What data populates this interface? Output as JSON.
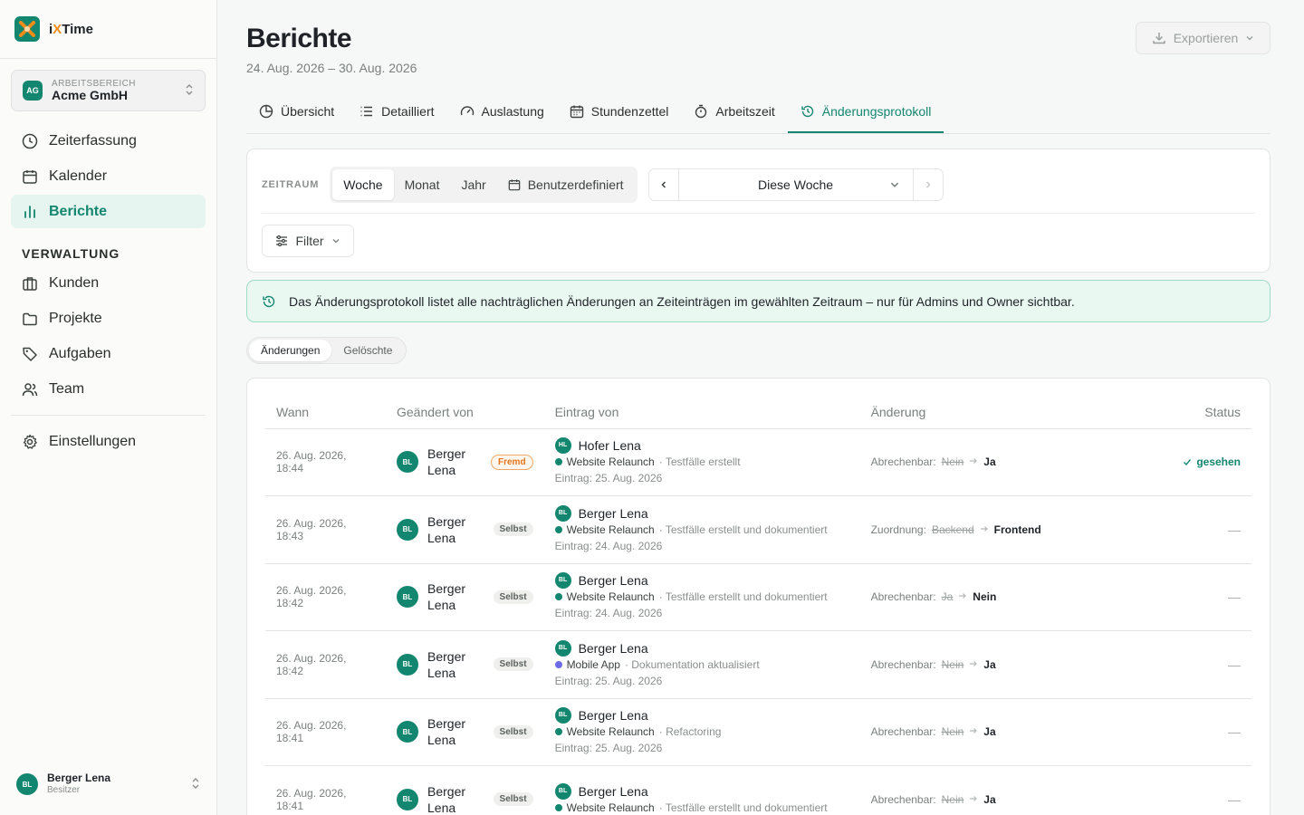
{
  "brand": {
    "name_prefix": "i",
    "name_x": "X",
    "name_suffix": "Time",
    "accent": "#13866f",
    "logo_accent": "#f08c1c"
  },
  "workspace": {
    "label": "ARBEITSBEREICH",
    "badge": "AG",
    "name": "Acme GmbH"
  },
  "nav": {
    "items": [
      {
        "label": "Zeiterfassung",
        "icon": "clock-icon"
      },
      {
        "label": "Kalender",
        "icon": "calendar-icon"
      },
      {
        "label": "Berichte",
        "icon": "bar-chart-icon",
        "active": true
      }
    ],
    "section": "VERWALTUNG",
    "admin_items": [
      {
        "label": "Kunden",
        "icon": "briefcase-icon"
      },
      {
        "label": "Projekte",
        "icon": "folder-icon"
      },
      {
        "label": "Aufgaben",
        "icon": "tag-icon"
      },
      {
        "label": "Team",
        "icon": "users-icon"
      }
    ],
    "settings": {
      "label": "Einstellungen",
      "icon": "gear-icon"
    }
  },
  "user": {
    "initials": "BL",
    "name": "Berger Lena",
    "role": "Besitzer"
  },
  "header": {
    "title": "Berichte",
    "subtitle": "24. Aug. 2026 – 30. Aug. 2026",
    "export_label": "Exportieren"
  },
  "tabs": [
    {
      "label": "Übersicht",
      "icon": "pie-icon"
    },
    {
      "label": "Detailliert",
      "icon": "list-icon"
    },
    {
      "label": "Auslastung",
      "icon": "gauge-icon"
    },
    {
      "label": "Stundenzettel",
      "icon": "calendar-icon"
    },
    {
      "label": "Arbeitszeit",
      "icon": "stopwatch-icon"
    },
    {
      "label": "Änderungsprotokoll",
      "icon": "history-icon",
      "active": true
    }
  ],
  "filters": {
    "zeitraum_label": "ZEITRAUM",
    "periods": [
      "Woche",
      "Monat",
      "Jahr"
    ],
    "custom_label": "Benutzerdefiniert",
    "current_period": "Diese Woche",
    "filter_label": "Filter"
  },
  "info_text": "Das Änderungsprotokoll listet alle nachträglichen Änderungen an Zeiteinträgen im gewählten Zeitraum – nur für Admins und Owner sichtbar.",
  "subtabs": [
    "Änderungen",
    "Gelöschte"
  ],
  "table": {
    "headers": {
      "when": "Wann",
      "by": "Geändert von",
      "entry": "Eintrag von",
      "change": "Änderung",
      "status": "Status"
    },
    "rows": [
      {
        "when": "26. Aug. 2026, 18:44",
        "by_initials": "BL",
        "by_first": "Berger",
        "by_last": "Lena",
        "pill": "Fremd",
        "pill_type": "fremd",
        "entry_initials": "HL",
        "entry_name": "Hofer Lena",
        "project": "Website Relaunch",
        "project_color": "#13866f",
        "task": " · Testfälle erstellt",
        "entry_date": "Eintrag: 25. Aug. 2026",
        "change_field": "Abrechenbar:",
        "old": "Nein",
        "new": "Ja",
        "status": "gesehen"
      },
      {
        "when": "26. Aug. 2026, 18:43",
        "by_initials": "BL",
        "by_first": "Berger",
        "by_last": "Lena",
        "pill": "Selbst",
        "pill_type": "selbst",
        "entry_initials": "BL",
        "entry_name": "Berger Lena",
        "project": "Website Relaunch",
        "project_color": "#13866f",
        "task": " · Testfälle erstellt und dokumentiert",
        "entry_date": "Eintrag: 24. Aug. 2026",
        "change_field": "Zuordnung:",
        "old": "Backend",
        "new": "Frontend",
        "status": "—"
      },
      {
        "when": "26. Aug. 2026, 18:42",
        "by_initials": "BL",
        "by_first": "Berger",
        "by_last": "Lena",
        "pill": "Selbst",
        "pill_type": "selbst",
        "entry_initials": "BL",
        "entry_name": "Berger Lena",
        "project": "Website Relaunch",
        "project_color": "#13866f",
        "task": " · Testfälle erstellt und dokumentiert",
        "entry_date": "Eintrag: 24. Aug. 2026",
        "change_field": "Abrechenbar:",
        "old": "Ja",
        "new": "Nein",
        "status": "—"
      },
      {
        "when": "26. Aug. 2026, 18:42",
        "by_initials": "BL",
        "by_first": "Berger",
        "by_last": "Lena",
        "pill": "Selbst",
        "pill_type": "selbst",
        "entry_initials": "BL",
        "entry_name": "Berger Lena",
        "project": "Mobile App",
        "project_color": "#6d6ae8",
        "task": " · Dokumentation aktualisiert",
        "entry_date": "Eintrag: 25. Aug. 2026",
        "change_field": "Abrechenbar:",
        "old": "Nein",
        "new": "Ja",
        "status": "—"
      },
      {
        "when": "26. Aug. 2026, 18:41",
        "by_initials": "BL",
        "by_first": "Berger",
        "by_last": "Lena",
        "pill": "Selbst",
        "pill_type": "selbst",
        "entry_initials": "BL",
        "entry_name": "Berger Lena",
        "project": "Website Relaunch",
        "project_color": "#13866f",
        "task": " · Refactoring",
        "entry_date": "Eintrag: 25. Aug. 2026",
        "change_field": "Abrechenbar:",
        "old": "Nein",
        "new": "Ja",
        "status": "—"
      },
      {
        "when": "26. Aug. 2026, 18:41",
        "by_initials": "BL",
        "by_first": "Berger",
        "by_last": "Lena",
        "pill": "Selbst",
        "pill_type": "selbst",
        "entry_initials": "BL",
        "entry_name": "Berger Lena",
        "project": "Website Relaunch",
        "project_color": "#13866f",
        "task": " · Testfälle erstellt und dokumentiert",
        "entry_date": "",
        "change_field": "Abrechenbar:",
        "old": "Nein",
        "new": "Ja",
        "status": "—"
      }
    ]
  }
}
